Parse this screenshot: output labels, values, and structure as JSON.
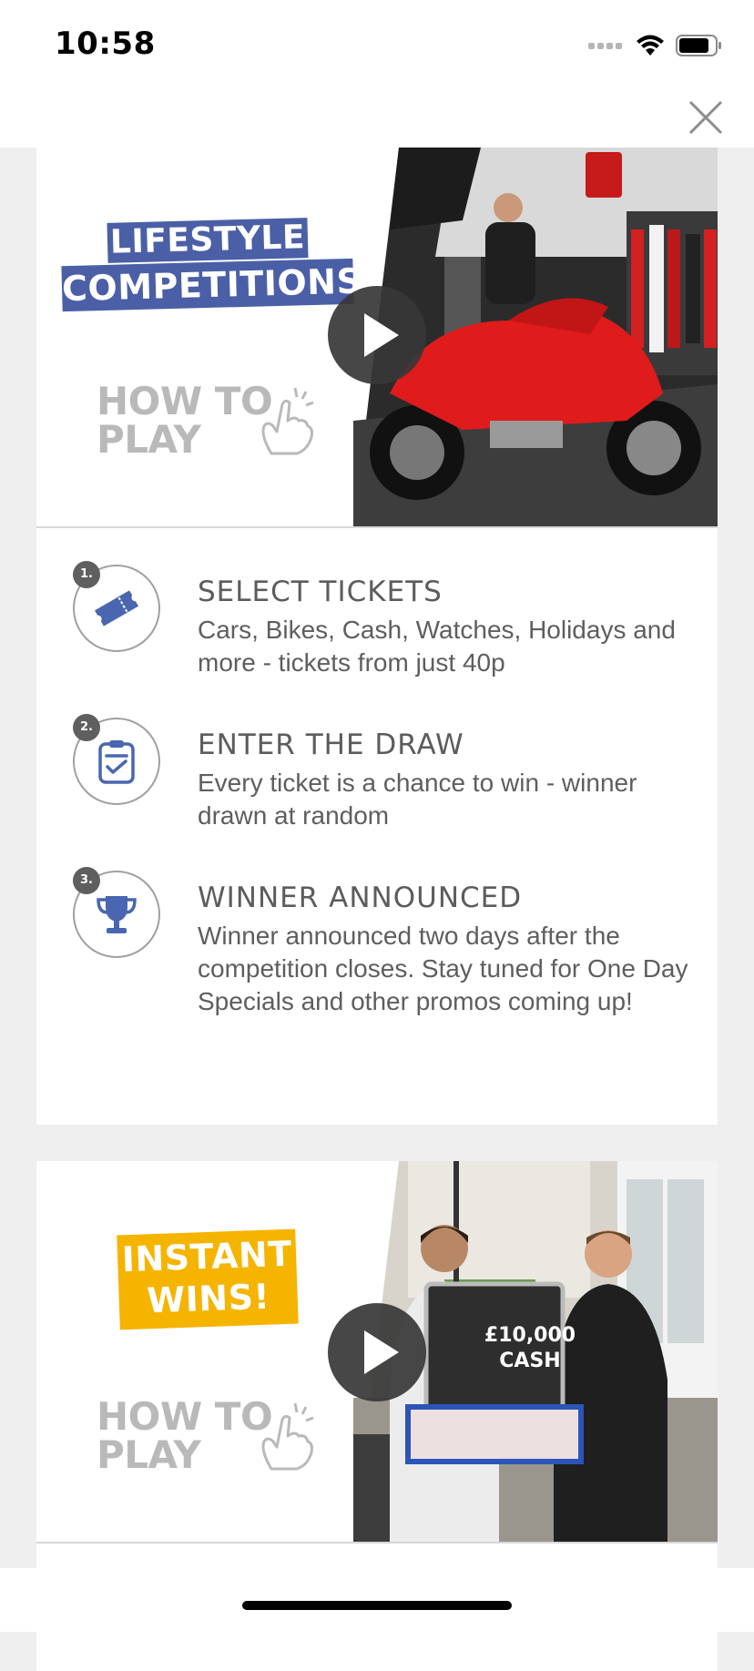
{
  "status_bar": {
    "time": "10:58"
  },
  "hero_lifestyle": {
    "tag_line1": "LIFESTYLE",
    "tag_line2": "COMPETITIONS",
    "tag_color": "#4a5fa6",
    "how_to_play_line1": "HOW TO",
    "how_to_play_line2": "PLAY"
  },
  "steps": [
    {
      "number": "1.",
      "title": "SELECT TICKETS",
      "description": "Cars, Bikes, Cash, Watches, Holidays and more - tickets from just 40p",
      "icon": "ticket-icon"
    },
    {
      "number": "2.",
      "title": "ENTER THE DRAW",
      "description": "Every ticket is a chance to win - winner drawn at random",
      "icon": "clipboard-check-icon"
    },
    {
      "number": "3.",
      "title": "WINNER ANNOUNCED",
      "description": "Winner announced two days after the competition closes. Stay tuned for One Day Specials and other promos coming up!",
      "icon": "trophy-icon"
    }
  ],
  "hero_instant": {
    "tag_line1": "INSTANT",
    "tag_line2": "WINS!",
    "tag_color": "#f5b400",
    "how_to_play_line1": "HOW TO",
    "how_to_play_line2": "PLAY",
    "sign_line1": "£10,000",
    "sign_line2": "CASH"
  },
  "colors": {
    "accent_blue": "#4a66b0",
    "text_gray": "#5e5e5e",
    "background": "#efefef"
  }
}
